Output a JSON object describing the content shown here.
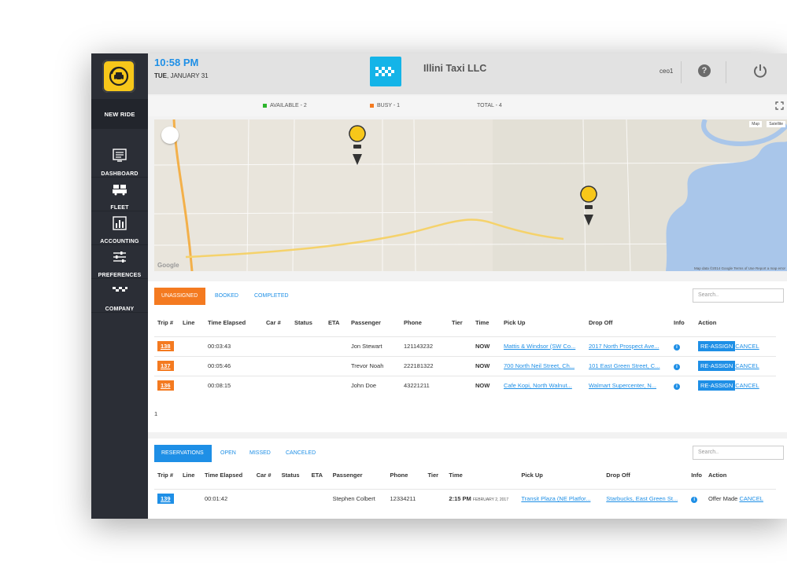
{
  "header": {
    "time": "10:58 PM",
    "day": "TUE",
    "date": ", JANUARY 31",
    "company_name": "Illini Taxi LLC",
    "user": "ceo1"
  },
  "sidebar": {
    "new_ride_label": "NEW RIDE",
    "items": [
      {
        "label": "DASHBOARD",
        "icon": "dashboard-icon"
      },
      {
        "label": "FLEET",
        "icon": "fleet-icon"
      },
      {
        "label": "ACCOUNTING",
        "icon": "accounting-icon"
      },
      {
        "label": "PREFERENCES",
        "icon": "preferences-icon"
      },
      {
        "label": "COMPANY",
        "icon": "company-icon"
      }
    ]
  },
  "status": {
    "available": "AVAILABLE - 2",
    "busy": "BUSY - 1",
    "total": "TOTAL - 4",
    "available_color": "#2cb52c",
    "busy_color": "#f47a20"
  },
  "map": {
    "map_button": "Map",
    "satellite_button": "Satellite",
    "attribution": "Map data ©2014 Google   Terms of Use   Report a map error",
    "google_logo": "Google"
  },
  "trips": {
    "tabs": [
      "UNASSIGNED",
      "BOOKED",
      "COMPLETED"
    ],
    "search_placeholder": "Search..",
    "columns": [
      "Trip #",
      "Line",
      "Time Elapsed",
      "Car #",
      "Status",
      "ETA",
      "Passenger",
      "Phone",
      "Tier",
      "Time",
      "Pick Up",
      "Drop Off",
      "Info",
      "Action"
    ],
    "rows": [
      {
        "trip": "138",
        "elapsed": "00:03:43",
        "passenger": "Jon Stewart",
        "phone": "121143232",
        "time": "NOW",
        "pickup": "Mattis & Windsor (SW Co...",
        "dropoff": "2017 North Prospect Ave...",
        "action_primary": "RE-ASSIGN",
        "action_secondary": "CANCEL"
      },
      {
        "trip": "137",
        "elapsed": "00:05:46",
        "passenger": "Trevor Noah",
        "phone": "222181322",
        "time": "NOW",
        "pickup": "700 North Neil Street, Ch...",
        "dropoff": "101 East Green Street, C...",
        "action_primary": "RE-ASSIGN",
        "action_secondary": "CANCEL"
      },
      {
        "trip": "136",
        "elapsed": "00:08:15",
        "passenger": "John Doe",
        "phone": "43221211",
        "time": "NOW",
        "pickup": "Cafe Kopi, North Walnut...",
        "dropoff": "Walmart Supercenter, N...",
        "action_primary": "RE-ASSIGN",
        "action_secondary": "CANCEL"
      }
    ],
    "page": "1"
  },
  "reservations": {
    "tabs": [
      "RESERVATIONS",
      "OPEN",
      "MISSED",
      "CANCELED"
    ],
    "search_placeholder": "Search..",
    "columns": [
      "Trip #",
      "Line",
      "Time Elapsed",
      "Car #",
      "Status",
      "ETA",
      "Passenger",
      "Phone",
      "Tier",
      "Time",
      "Pick Up",
      "Drop Off",
      "Info",
      "Action"
    ],
    "rows": [
      {
        "trip": "139",
        "elapsed": "00:01:42",
        "passenger": "Stephen Colbert",
        "phone": "12334211",
        "time": "2:15 PM",
        "time_date": "FEBRUARY 2, 2017",
        "pickup": "Transit Plaza (NE Platfor...",
        "dropoff": "Starbucks, East Green St...",
        "action_text": "Offer Made",
        "action_secondary": "CANCEL"
      }
    ]
  }
}
